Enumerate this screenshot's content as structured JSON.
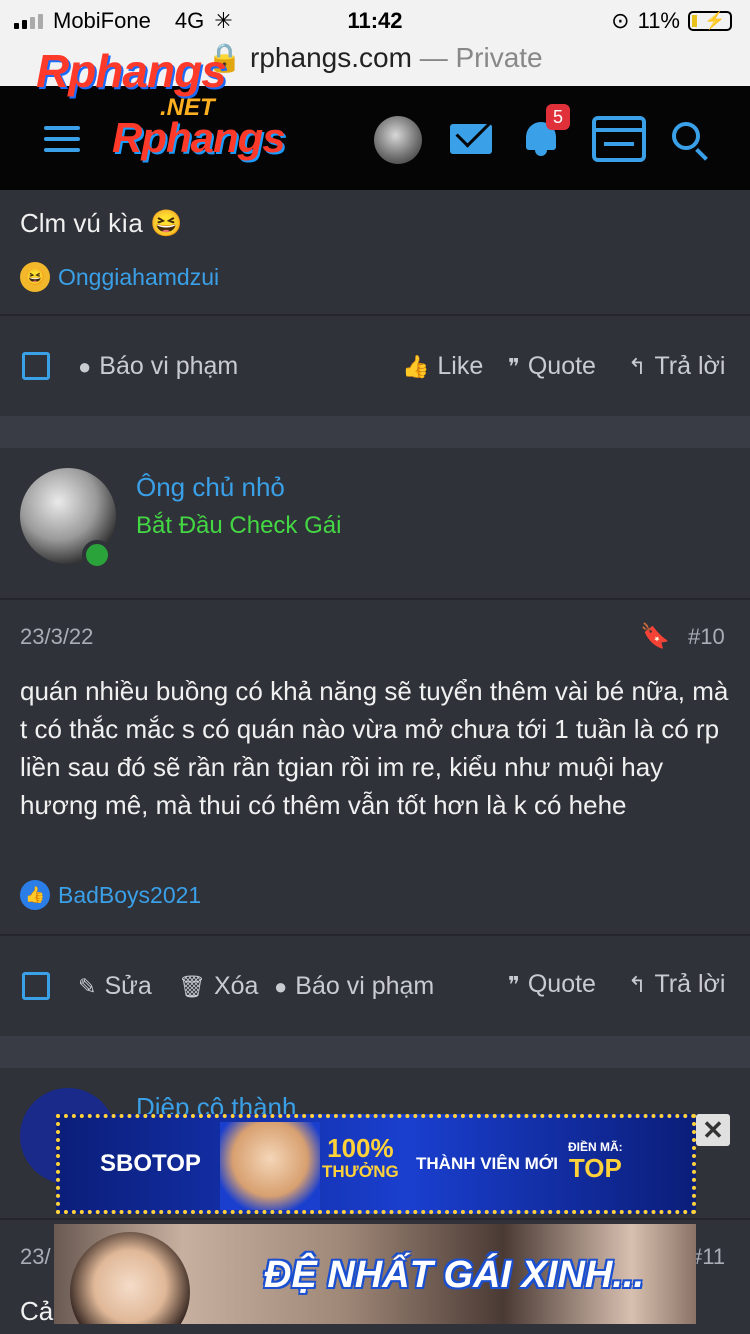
{
  "status_bar": {
    "carrier": "MobiFone",
    "network": "4G",
    "time": "11:42",
    "battery": "11%"
  },
  "url_bar": {
    "domain": "rphangs.com",
    "mode": "— Private"
  },
  "header": {
    "logo_top": "Rphangs",
    "logo_net": ".NET",
    "logo_main": "Rphangs",
    "notification_count": "5",
    "accent_color": "#3aa0e8"
  },
  "post_prev": {
    "content": "Clm vú kìa 😆",
    "reaction_user": "Onggiahamdzui",
    "actions": {
      "report": "Báo vi phạm",
      "like": "Like",
      "quote": "Quote",
      "reply": "Trả lời"
    }
  },
  "post_10": {
    "author": "Ông chủ nhỏ",
    "user_title": "Bắt Đầu Check Gái",
    "date": "23/3/22",
    "number": "#10",
    "content": "quán nhiều buồng có khả năng sẽ tuyển thêm vài bé nữa, mà t có thắc mắc s có quán nào vừa mở chưa tới 1 tuần là có rp liền sau đó sẽ rần rần tgian rồi im re, kiểu như muội hay hương mê, mà thui có thêm vẫn tốt hơn là k có hehe",
    "reaction_user": "BadBoys2021",
    "actions": {
      "edit": "Sửa",
      "delete": "Xóa",
      "report": "Báo vi phạm",
      "quote": "Quote",
      "reply": "Trả lời"
    }
  },
  "post_11": {
    "author": "Diệp cô thành",
    "date": "23/",
    "number": "#11",
    "content": "Cả"
  },
  "ads": {
    "banner1": {
      "brand": "SBOTOP",
      "percent": "100%",
      "percent_sub": "THƯỞNG",
      "member": "THÀNH VIÊN MỚI",
      "code_label": "ĐIỀN MÃ:",
      "code": "TOP"
    },
    "banner2": {
      "text": "ĐỆ NHẤT GÁI XINH..."
    },
    "close": "✕"
  }
}
